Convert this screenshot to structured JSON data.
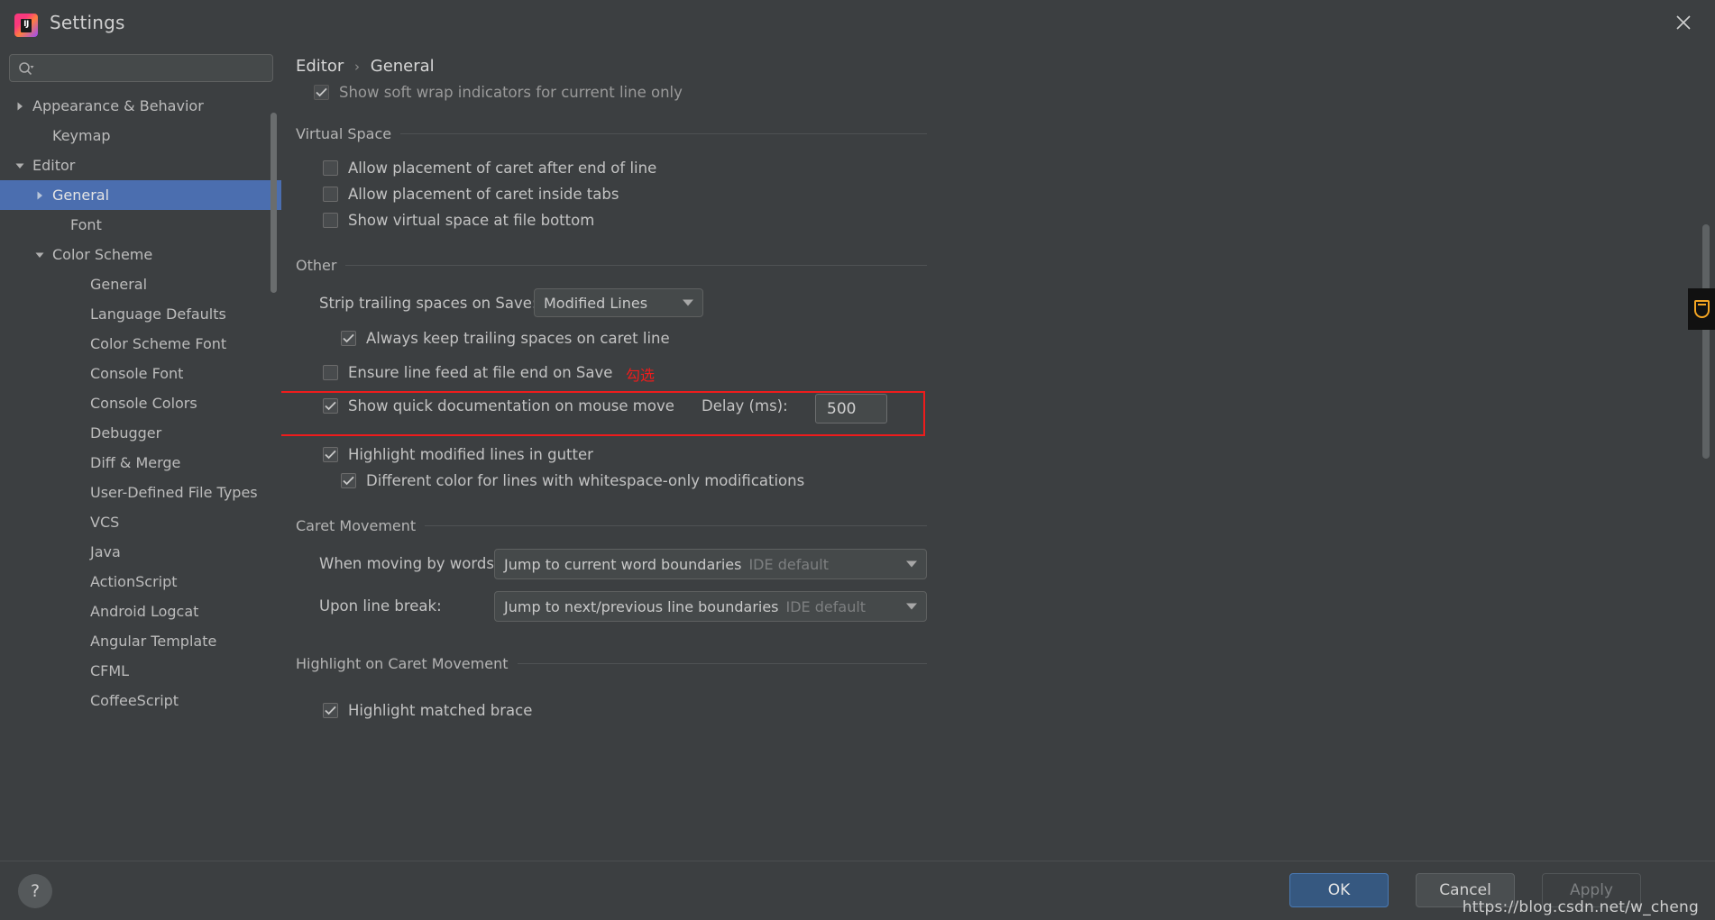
{
  "window": {
    "title": "Settings",
    "logo_text": "IJ",
    "close_icon": "close-icon"
  },
  "search": {
    "value": "",
    "placeholder": "",
    "icon": "search-icon"
  },
  "sidebar": {
    "items": [
      {
        "label": "Appearance & Behavior",
        "indent": 0,
        "arrow": "collapsed",
        "selected": false
      },
      {
        "label": "Keymap",
        "indent": 1,
        "arrow": "none",
        "selected": false
      },
      {
        "label": "Editor",
        "indent": 0,
        "arrow": "expanded",
        "selected": false
      },
      {
        "label": "General",
        "indent": 1,
        "arrow": "collapsed",
        "selected": true
      },
      {
        "label": "Font",
        "indent": 2,
        "arrow": "none",
        "selected": false
      },
      {
        "label": "Color Scheme",
        "indent": 1,
        "arrow": "expanded",
        "selected": false
      },
      {
        "label": "General",
        "indent": 3,
        "arrow": "none",
        "selected": false
      },
      {
        "label": "Language Defaults",
        "indent": 3,
        "arrow": "none",
        "selected": false
      },
      {
        "label": "Color Scheme Font",
        "indent": 3,
        "arrow": "none",
        "selected": false
      },
      {
        "label": "Console Font",
        "indent": 3,
        "arrow": "none",
        "selected": false
      },
      {
        "label": "Console Colors",
        "indent": 3,
        "arrow": "none",
        "selected": false
      },
      {
        "label": "Debugger",
        "indent": 3,
        "arrow": "none",
        "selected": false
      },
      {
        "label": "Diff & Merge",
        "indent": 3,
        "arrow": "none",
        "selected": false
      },
      {
        "label": "User-Defined File Types",
        "indent": 3,
        "arrow": "none",
        "selected": false
      },
      {
        "label": "VCS",
        "indent": 3,
        "arrow": "none",
        "selected": false
      },
      {
        "label": "Java",
        "indent": 3,
        "arrow": "none",
        "selected": false
      },
      {
        "label": "ActionScript",
        "indent": 3,
        "arrow": "none",
        "selected": false
      },
      {
        "label": "Android Logcat",
        "indent": 3,
        "arrow": "none",
        "selected": false
      },
      {
        "label": "Angular Template",
        "indent": 3,
        "arrow": "none",
        "selected": false
      },
      {
        "label": "CFML",
        "indent": 3,
        "arrow": "none",
        "selected": false
      },
      {
        "label": "CoffeeScript",
        "indent": 3,
        "arrow": "none",
        "selected": false
      }
    ]
  },
  "breadcrumb": {
    "root": "Editor",
    "separator": "›",
    "current": "General"
  },
  "main": {
    "soft_wrap": {
      "label": "Show soft wrap indicators for current line only",
      "checked": true
    },
    "virtual_space": {
      "title": "Virtual Space",
      "options": [
        {
          "label": "Allow placement of caret after end of line",
          "checked": false
        },
        {
          "label": "Allow placement of caret inside tabs",
          "checked": false
        },
        {
          "label": "Show virtual space at file bottom",
          "checked": false
        }
      ]
    },
    "other": {
      "title": "Other",
      "strip_label": "Strip trailing spaces on Save:",
      "strip_value": "Modified Lines",
      "always_keep": {
        "label": "Always keep trailing spaces on caret line",
        "checked": true
      },
      "ensure_lf": {
        "label": "Ensure line feed at file end on Save",
        "checked": false
      },
      "quick_doc": {
        "label": "Show quick documentation on mouse move",
        "checked": true
      },
      "delay_label": "Delay (ms):",
      "delay_value": "500",
      "highlight_gutter": {
        "label": "Highlight modified lines in gutter",
        "checked": true
      },
      "different_color": {
        "label": "Different color for lines with whitespace-only modifications",
        "checked": true
      }
    },
    "caret_movement": {
      "title": "Caret Movement",
      "words_label": "When moving by words:",
      "words_value": "Jump to current word boundaries",
      "words_hint": "IDE default",
      "linebreak_label": "Upon line break:",
      "linebreak_value": "Jump to next/previous line boundaries",
      "linebreak_hint": "IDE default"
    },
    "highlight_caret": {
      "title": "Highlight on Caret Movement",
      "matched_brace": {
        "label": "Highlight matched brace",
        "checked": true
      }
    }
  },
  "annotation": {
    "text": "勾选",
    "color": "#ee1c1c"
  },
  "footer": {
    "help_label": "?",
    "ok_label": "OK",
    "cancel_label": "Cancel",
    "apply_label": "Apply",
    "watermark": "https://blog.csdn.net/w_cheng"
  },
  "colors": {
    "accent": "#4b6eaf",
    "primary_button": "#365880",
    "annotation": "#ee1c1c",
    "background": "#3c3f41"
  }
}
